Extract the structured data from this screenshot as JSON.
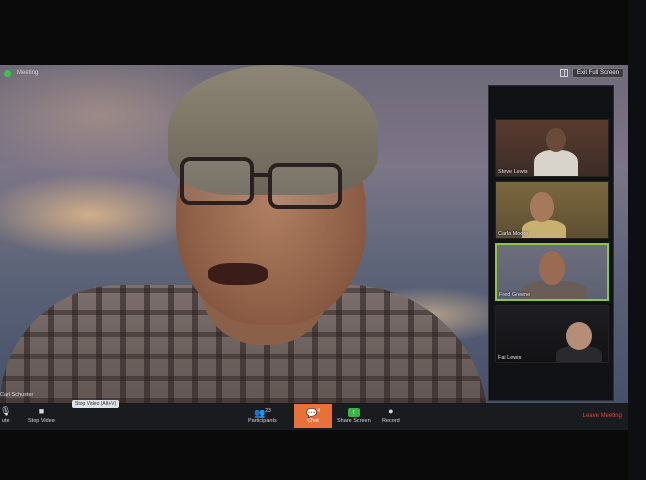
{
  "meeting": {
    "title": "Meeting",
    "exit_fullscreen": "Exit Full Screen",
    "speaker_name": "Carl Schuster"
  },
  "participants": [
    {
      "name": "Steve Lewis"
    },
    {
      "name": "Carla Moore"
    },
    {
      "name": "Fred Greene"
    },
    {
      "name": "Fai Lewis"
    }
  ],
  "toolbar": {
    "audio_label": "ute",
    "video_label": "Stop Video",
    "video_tooltip": "Stop Video (Alt+V)",
    "participants_label": "Participants",
    "participants_count": "23",
    "chat_label": "Chat",
    "chat_count": "4",
    "share_label": "Share Screen",
    "record_label": "Record",
    "leave_label": "Leave Meeting"
  },
  "colors": {
    "chat_highlight": "#e8713a",
    "share_green": "#3bb34a",
    "leave_red": "#e0413b",
    "active_speaker_border": "#8ec63f"
  },
  "icons": {
    "encryption": "shield-icon",
    "gallery": "gallery-view-icon",
    "audio": "microphone-icon",
    "video": "camera-icon",
    "participants": "people-icon",
    "chat": "chat-bubble-icon",
    "share": "share-screen-icon",
    "record": "record-icon"
  }
}
